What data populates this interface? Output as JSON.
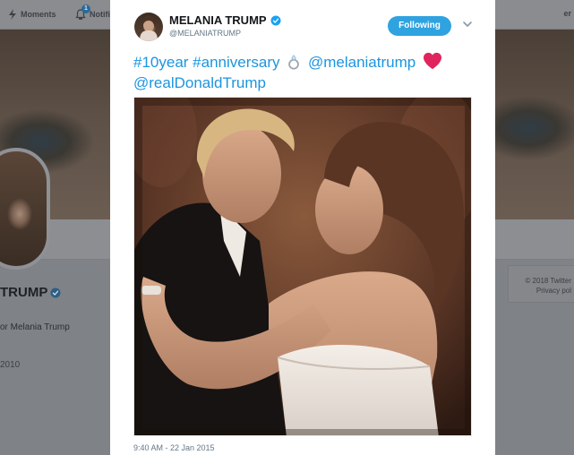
{
  "background": {
    "nav": {
      "moments_label": "Moments",
      "notifications_label": "Notifi",
      "notifications_count": "1",
      "right_fragment": "er"
    },
    "profile": {
      "name_fragment": "TRUMP",
      "bio_fragment": "or Melania Trump",
      "joined_fragment": "2010"
    },
    "footer": {
      "copyright": "© 2018 Twitter",
      "privacy": "Privacy pol"
    }
  },
  "tweet": {
    "author_name": "MELANIA TRUMP",
    "author_handle": "@MELANIATRUMP",
    "follow_label": "Following",
    "text": {
      "hashtag_1": "#10year",
      "hashtag_2": "#anniversary",
      "mention_1": "@melaniatrump",
      "mention_2": "@realDonaldTrump"
    },
    "timestamp": "9:40 AM - 22 Jan 2015"
  },
  "icons": {
    "verified": "verified-badge-icon",
    "ring": "ring-emoji-icon",
    "heart": "red-heart-emoji-icon",
    "caret": "chevron-down-icon",
    "moments": "lightning-icon",
    "notifications": "bell-icon"
  },
  "colors": {
    "link": "#1b95e0",
    "follow_button": "#2fa3e0",
    "verified": "#1da1f2",
    "heart": "#e0245e"
  }
}
